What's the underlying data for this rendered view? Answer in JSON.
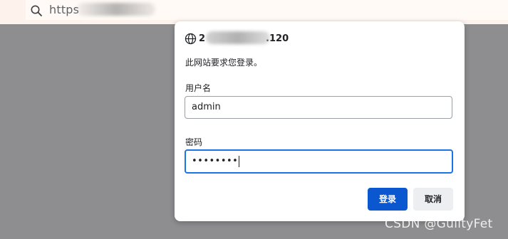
{
  "browser": {
    "address_bar": {
      "url_prefix": "https",
      "url_redacted": true
    }
  },
  "dialog": {
    "host_visible": "2",
    "host_suffix": ".120",
    "host_redacted": true,
    "message": "此网站要求您登录。",
    "username": {
      "label": "用户名",
      "value": "admin"
    },
    "password": {
      "label": "密码",
      "masked_value": "••••••••",
      "focused": true
    },
    "buttons": {
      "login": "登录",
      "cancel": "取消"
    }
  },
  "watermark": "CSDN @GuiltyFet",
  "colors": {
    "backdrop": "#8e8e90",
    "primary_button": "#0b57d0",
    "focus_border": "#1a73e8",
    "secondary_button": "#eceef1"
  },
  "icons": {
    "address_bar": "search-icon",
    "dialog_header": "globe-icon"
  }
}
